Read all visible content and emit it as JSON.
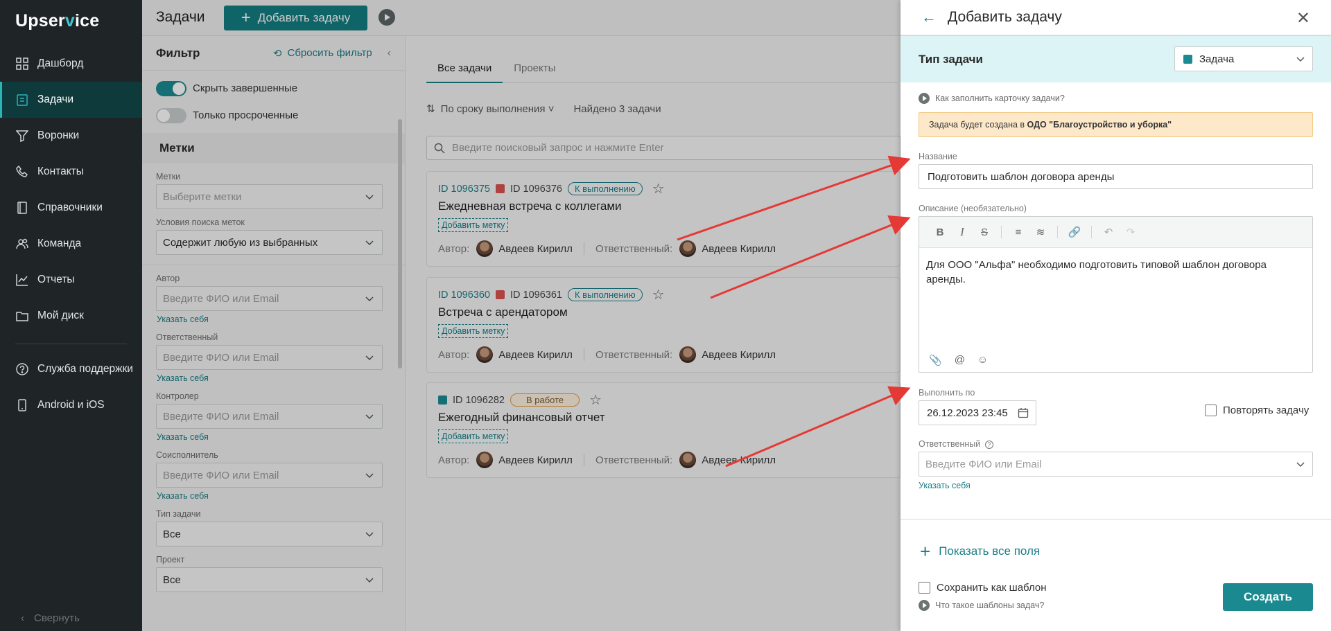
{
  "sidebar": {
    "logo_prefix": "Upser",
    "logo_accent": "v",
    "logo_suffix": "ice",
    "items": [
      {
        "label": "Дашборд",
        "icon": "dashboard-icon"
      },
      {
        "label": "Задачи",
        "icon": "tasks-icon",
        "active": true
      },
      {
        "label": "Воронки",
        "icon": "funnel-icon"
      },
      {
        "label": "Контакты",
        "icon": "phone-icon"
      },
      {
        "label": "Справочники",
        "icon": "book-icon"
      },
      {
        "label": "Команда",
        "icon": "team-icon"
      },
      {
        "label": "Отчеты",
        "icon": "chart-icon"
      },
      {
        "label": "Мой диск",
        "icon": "folder-icon"
      }
    ],
    "bottom_items": [
      {
        "label": "Служба поддержки",
        "icon": "help-icon"
      },
      {
        "label": "Android и iOS",
        "icon": "mobile-icon"
      }
    ],
    "collapse_label": "Свернуть"
  },
  "topbar": {
    "title": "Задачи",
    "add_button": "Добавить задачу"
  },
  "filter": {
    "title": "Фильтр",
    "reset_label": "Сбросить фильтр",
    "toggles": [
      {
        "label": "Скрыть завершенные",
        "on": true
      },
      {
        "label": "Только просроченные",
        "on": false
      }
    ],
    "tags_section": "Метки",
    "tags_label": "Метки",
    "tags_placeholder": "Выберите метки",
    "tags_condition_label": "Условия поиска меток",
    "tags_condition_value": "Содержит любую из выбранных",
    "fields": [
      {
        "label": "Автор",
        "placeholder": "Введите ФИО или Email",
        "link": "Указать себя"
      },
      {
        "label": "Ответственный",
        "placeholder": "Введите ФИО или Email",
        "link": "Указать себя"
      },
      {
        "label": "Контролер",
        "placeholder": "Введите ФИО или Email",
        "link": "Указать себя"
      },
      {
        "label": "Соисполнитель",
        "placeholder": "Введите ФИО или Email",
        "link": "Указать себя"
      }
    ],
    "type_label": "Тип задачи",
    "type_value": "Все",
    "project_label": "Проект",
    "project_value": "Все"
  },
  "main": {
    "tabs": [
      "Все задачи",
      "Проекты"
    ],
    "sort_label": "По сроку выполнения",
    "found_label": "Найдено 3 задачи",
    "search_placeholder": "Введите поисковый запрос и нажмите Enter",
    "add_tag_label": "Добавить метку",
    "author_label": "Автор:",
    "responsible_label": "Ответственный:",
    "cards": [
      {
        "id1": "ID 1096375",
        "id2": "ID 1096376",
        "status": "К выполнению",
        "title": "Ежедневная встреча с коллегами",
        "author": "Авдеев Кирилл",
        "responsible": "Авдеев Кирилл"
      },
      {
        "id1": "ID 1096360",
        "id2": "ID 1096361",
        "status": "К выполнению",
        "title": "Встреча с арендатором",
        "author": "Авдеев Кирилл",
        "responsible": "Авдеев Кирилл"
      },
      {
        "id1": "",
        "id2": "ID 1096282",
        "status": "В работе",
        "title": "Ежегодный финансовый отчет",
        "author": "Авдеев Кирилл",
        "responsible": "Авдеев Кирилл"
      }
    ]
  },
  "modal": {
    "title": "Добавить задачу",
    "type_label": "Тип задачи",
    "type_value": "Задача",
    "help_fill": "Как заполнить карточку задачи?",
    "notice_prefix": "Задача будет создана в ",
    "notice_org": "ОДО \"Благоустройство и уборка\"",
    "name_label": "Название",
    "name_value": "Подготовить шаблон договора аренды",
    "desc_label": "Описание (необязательно)",
    "desc_value": "Для ООО \"Альфа\" необходимо подготовить типовой шаблон договора аренды.",
    "due_label": "Выполнить по",
    "due_value": "26.12.2023 23:45",
    "repeat_label": "Повторять задачу",
    "responsible_label": "Ответственный",
    "responsible_placeholder": "Введите ФИО или Email",
    "self_link": "Указать себя",
    "show_all": "Показать все поля",
    "save_template": "Сохранить как шаблон",
    "help_templates": "Что такое шаблоны задач?",
    "create_button": "Создать"
  },
  "colors": {
    "accent": "#1b7e86",
    "arrow": "#e53935",
    "sidebar_bg": "#1f2426"
  }
}
